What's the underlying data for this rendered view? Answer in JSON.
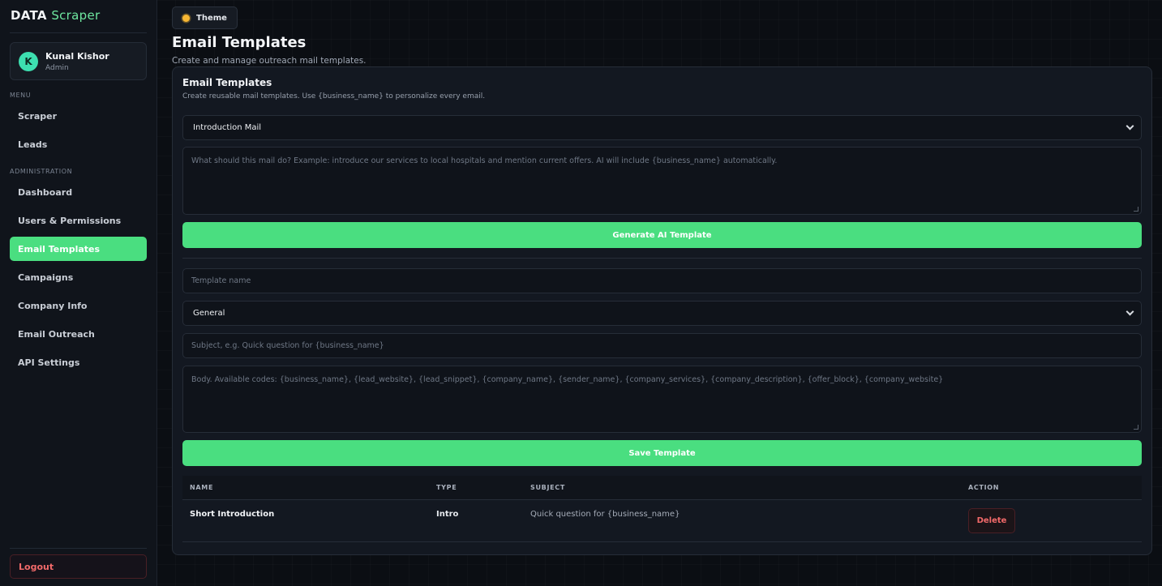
{
  "brand": {
    "name_part1": "DATA",
    "name_part2": "Scraper"
  },
  "user": {
    "initial": "K",
    "name": "Kunal Kishor",
    "role": "Admin"
  },
  "sidebar": {
    "menu_label": "MENU",
    "menu_items": [
      {
        "label": "Scraper"
      },
      {
        "label": "Leads"
      }
    ],
    "admin_label": "ADMINISTRATION",
    "admin_items": [
      {
        "label": "Dashboard"
      },
      {
        "label": "Users & Permissions"
      },
      {
        "label": "Email Templates",
        "active": true
      },
      {
        "label": "Campaigns"
      },
      {
        "label": "Company Info"
      },
      {
        "label": "Email Outreach"
      },
      {
        "label": "API Settings"
      }
    ],
    "logout_label": "Logout"
  },
  "header": {
    "theme_label": "Theme",
    "title": "Email Templates",
    "subtitle": "Create and manage outreach mail templates."
  },
  "card": {
    "title": "Email Templates",
    "subtitle": "Create reusable mail templates. Use {business_name} to personalize every email.",
    "template_type_selected": "Introduction Mail",
    "prompt_placeholder": "What should this mail do? Example: introduce our services to local hospitals and mention current offers. AI will include {business_name} automatically.",
    "generate_label": "Generate AI Template",
    "name_placeholder": "Template name",
    "category_selected": "General",
    "subject_placeholder": "Subject, e.g. Quick question for {business_name}",
    "body_placeholder": "Body. Available codes: {business_name}, {lead_website}, {lead_snippet}, {company_name}, {sender_name}, {company_services}, {company_description}, {offer_block}, {company_website}",
    "save_label": "Save Template"
  },
  "table": {
    "headers": {
      "name": "NAME",
      "type": "TYPE",
      "subject": "SUBJECT",
      "action": "ACTION"
    },
    "rows": [
      {
        "name": "Short Introduction",
        "type": "Intro",
        "subject": "Quick question for {business_name}",
        "action": "Delete"
      }
    ]
  },
  "colors": {
    "accent": "#4ade80",
    "danger": "#f26a6a",
    "avatar": "#3ddfb0"
  }
}
